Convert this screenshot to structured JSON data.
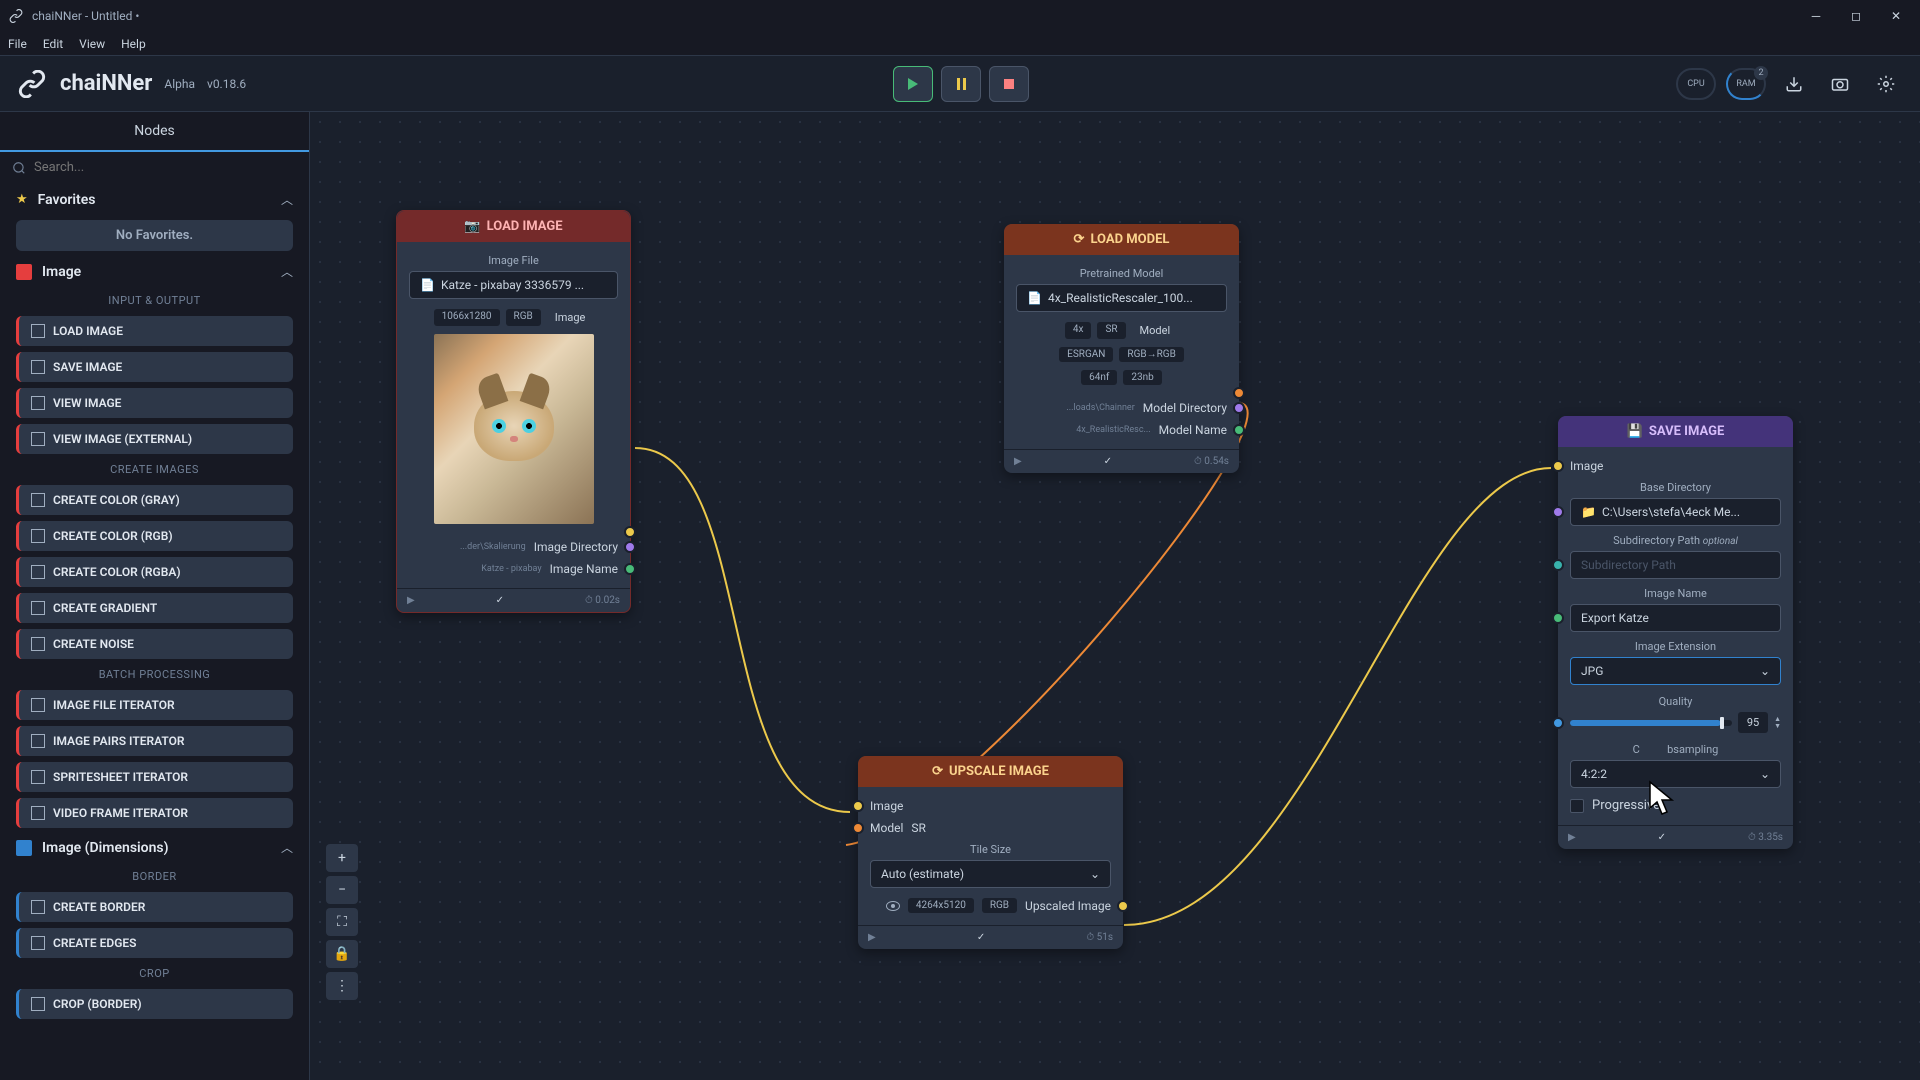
{
  "window": {
    "title": "chaiNNer - Untitled •"
  },
  "menubar": {
    "file": "File",
    "edit": "Edit",
    "view": "View",
    "help": "Help"
  },
  "brand": {
    "name": "chaiNNer",
    "alpha": "Alpha",
    "version": "v0.18.6"
  },
  "monitor": {
    "cpu": "CPU",
    "ram": "RAM",
    "ram_badge": "2"
  },
  "sidebar": {
    "tab": "Nodes",
    "search_placeholder": "Search...",
    "favorites": {
      "title": "Favorites",
      "empty": "No Favorites."
    },
    "image_cat": "Image",
    "io_label": "INPUT & OUTPUT",
    "create_label": "CREATE IMAGES",
    "batch_label": "BATCH PROCESSING",
    "dim_cat": "Image (Dimensions)",
    "border_label": "BORDER",
    "crop_label": "CROP",
    "items": {
      "load_image": "LOAD IMAGE",
      "save_image": "SAVE IMAGE",
      "view_image": "VIEW IMAGE",
      "view_ext": "VIEW IMAGE (EXTERNAL)",
      "cc_gray": "CREATE COLOR (GRAY)",
      "cc_rgb": "CREATE COLOR (RGB)",
      "cc_rgba": "CREATE COLOR (RGBA)",
      "gradient": "CREATE GRADIENT",
      "noise": "CREATE NOISE",
      "file_iter": "IMAGE FILE ITERATOR",
      "pairs_iter": "IMAGE PAIRS ITERATOR",
      "sprite_iter": "SPRITESHEET ITERATOR",
      "video_iter": "VIDEO FRAME ITERATOR",
      "cborder": "CREATE BORDER",
      "cedges": "CREATE EDGES",
      "cropb": "CROP (BORDER)"
    }
  },
  "nodes": {
    "load": {
      "title": "LOAD IMAGE",
      "file_label": "Image File",
      "file_value": "Katze - pixabay 3336579 ...",
      "dims": "1066x1280",
      "mode": "RGB",
      "type": "Image",
      "dir_hint": "...der\\Skalierung",
      "dir_label": "Image Directory",
      "name_hint": "Katze - pixabay",
      "name_label": "Image Name",
      "time": "⏱ 0.02s"
    },
    "model": {
      "title": "LOAD MODEL",
      "file_label": "Pretrained Model",
      "file_value": "4x_RealisticRescaler_100...",
      "scale": "4x",
      "sr": "SR",
      "type": "Model",
      "arch": "ESRGAN",
      "ch": "RGB→RGB",
      "nf": "64nf",
      "nb": "23nb",
      "dir_hint": "...loads\\Chainner",
      "dir_label": "Model Directory",
      "name_hint": "4x_RealisticResc...",
      "name_label": "Model Name",
      "time": "⏱ 0.54s"
    },
    "upscale": {
      "title": "UPSCALE IMAGE",
      "in_image": "Image",
      "in_model": "Model",
      "sr": "SR",
      "tile_label": "Tile Size",
      "tile_value": "Auto (estimate)",
      "out_dims": "4264x5120",
      "out_mode": "RGB",
      "out_label": "Upscaled Image",
      "time": "⏱ 51s"
    },
    "save": {
      "title": "SAVE IMAGE",
      "in_image": "Image",
      "dir_label": "Base Directory",
      "dir_value": "C:\\Users\\stefa\\4eck Me...",
      "sub_label": "Subdirectory Path",
      "sub_opt": "optional",
      "sub_placeholder": "Subdirectory Path",
      "name_label": "Image Name",
      "name_value": "Export Katze",
      "ext_label": "Image Extension",
      "ext_value": "JPG",
      "q_label": "Quality",
      "q_value": "95",
      "chroma_label": "bsampling",
      "chroma_prefix": "C",
      "chroma_value": "4:2:2",
      "prog_label": "Progressive",
      "time": "⏱ 3.35s"
    }
  }
}
